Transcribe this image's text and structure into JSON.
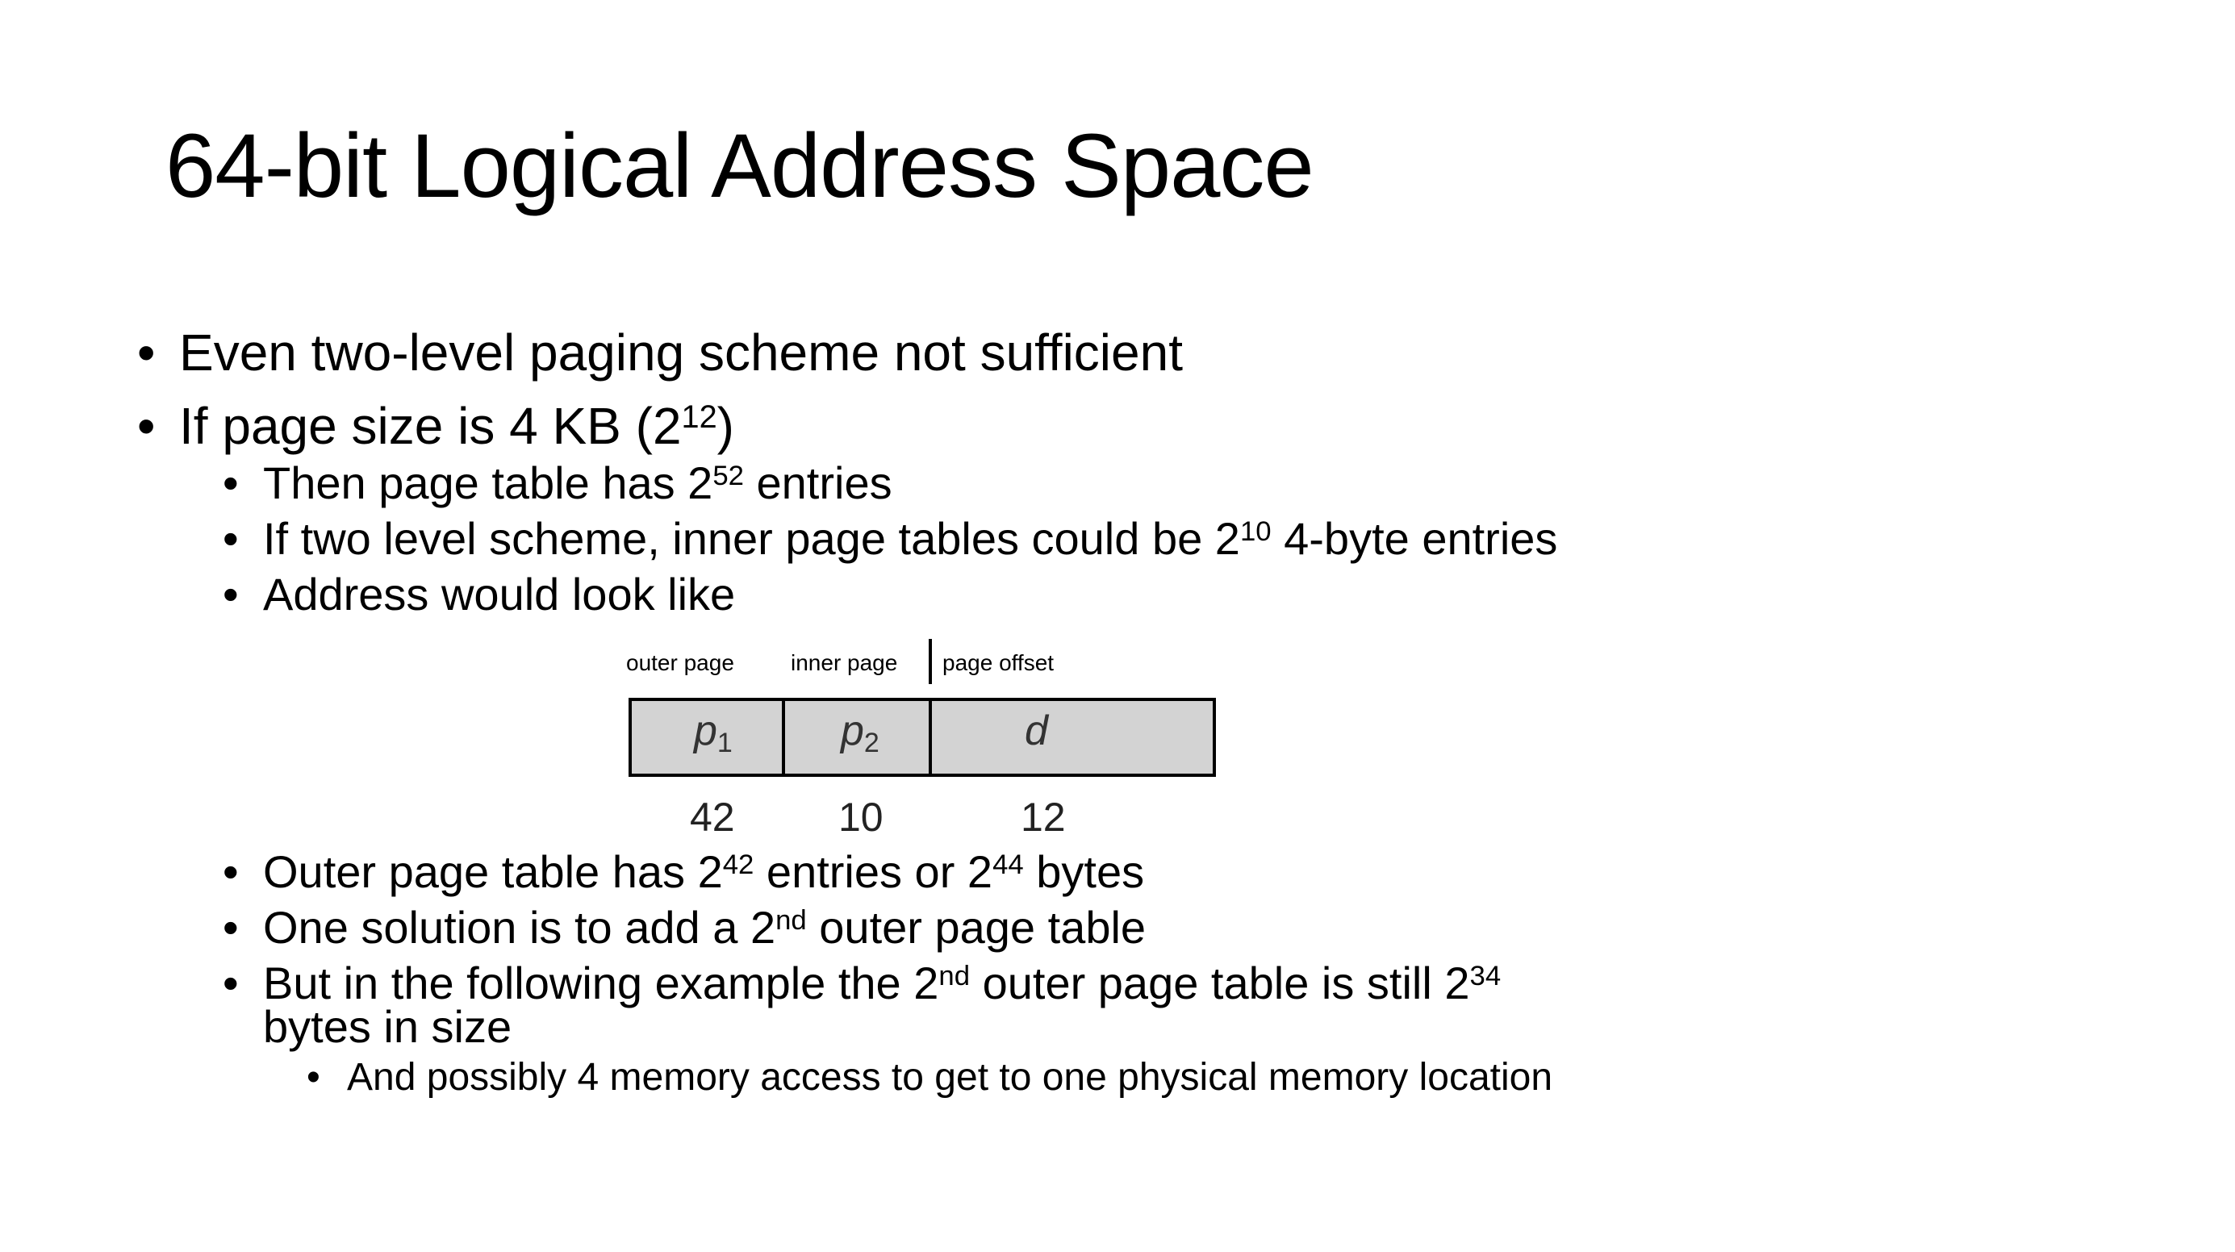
{
  "title": "64-bit Logical Address Space",
  "bullet_char": "•",
  "bullets": [
    {
      "pre": "Even two-level paging scheme not sufficient"
    },
    {
      "pre": "If page size is 4 KB (2",
      "sup": "12",
      "post": ")"
    },
    {
      "pre": "Then page table has 2",
      "sup": "52",
      "post": " entries"
    },
    {
      "pre": "If two level scheme, inner page tables could be 2",
      "sup": "10",
      "post": " 4-byte entries"
    },
    {
      "pre": "Address would look like"
    },
    {
      "pre": "Outer page table has 2",
      "sup": "42",
      "mid": " entries or 2",
      "sup2": "44",
      "post": " bytes"
    },
    {
      "pre": "One solution is to add a 2",
      "sup": "nd",
      "post": " outer page table"
    },
    {
      "pre": "But in the following example the 2",
      "sup": "nd",
      "mid": " outer page table is still 2",
      "sup2": "34",
      "post2": "bytes in size"
    },
    {
      "pre": "And possibly 4 memory access to get to one physical memory location"
    }
  ],
  "address_figure": {
    "headers": [
      "outer page",
      "inner page",
      "page offset"
    ],
    "fields": [
      {
        "symbol": "p",
        "subscript": "1"
      },
      {
        "symbol": "p",
        "subscript": "2"
      },
      {
        "symbol": "d",
        "subscript": ""
      }
    ],
    "bits": [
      "42",
      "10",
      "12"
    ]
  }
}
